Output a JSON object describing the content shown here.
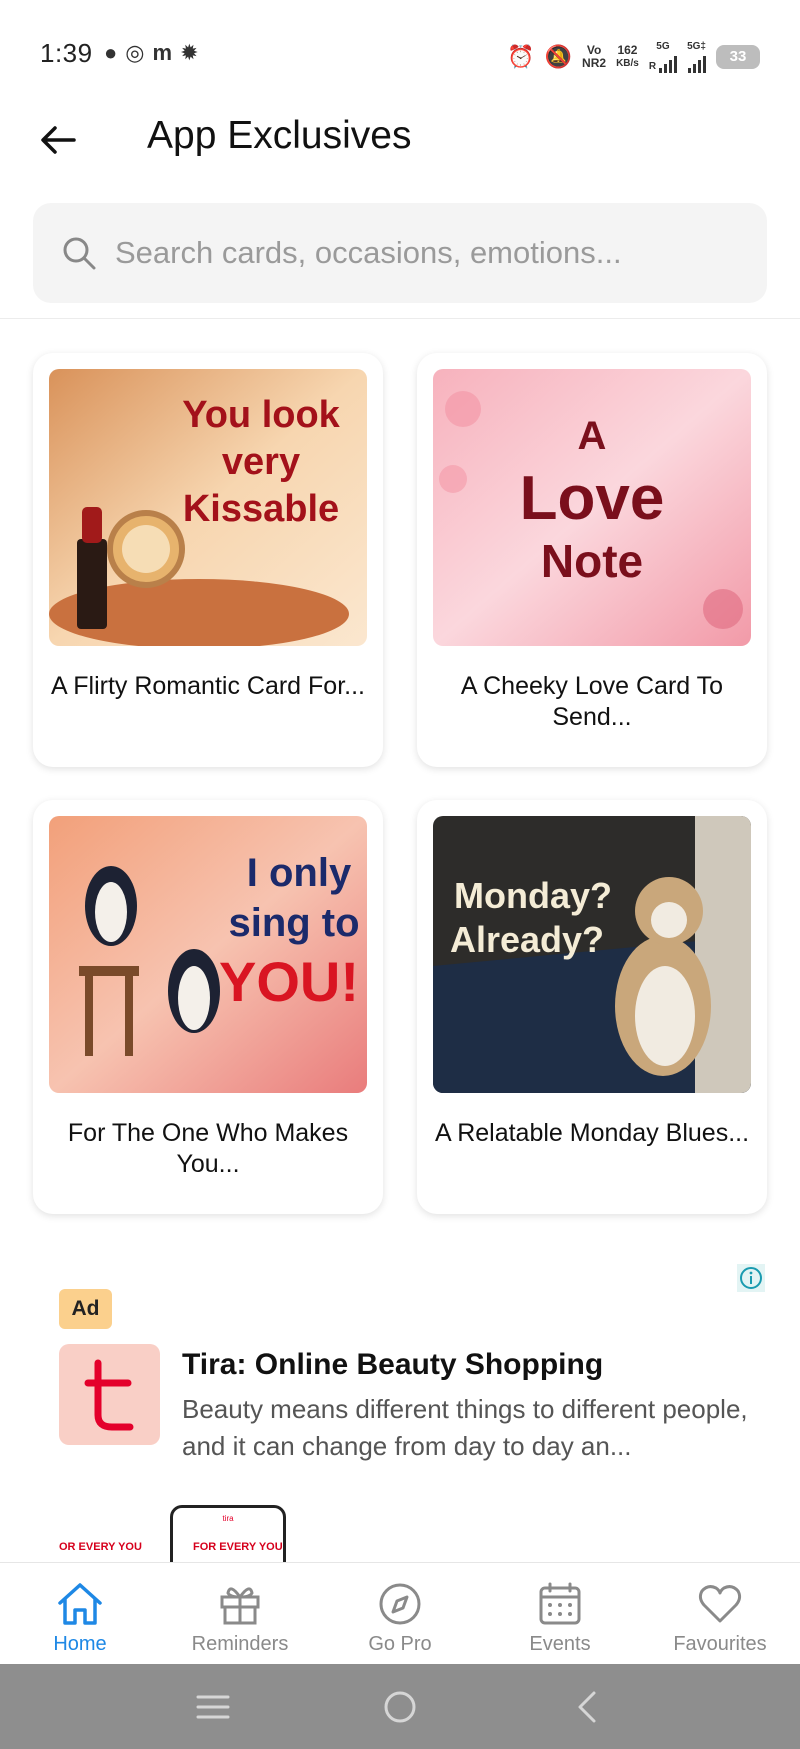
{
  "status_bar": {
    "time": "1:39",
    "net_vo": "Vo",
    "net_nr2": "NR2",
    "speed_value": "162",
    "speed_unit": "KB/s",
    "sig1_top": "5G",
    "sig1_bottom": "R",
    "sig2_top": "5G‡",
    "battery": "33"
  },
  "header": {
    "title": "App Exclusives"
  },
  "search": {
    "placeholder": "Search cards, occasions, emotions..."
  },
  "cards": [
    {
      "caption": "A Flirty Romantic Card For...",
      "image_lines": [
        "You look",
        "very",
        "Kissable"
      ]
    },
    {
      "caption": "A Cheeky Love Card To Send...",
      "image_lines": [
        "A",
        "Love",
        "Note"
      ]
    },
    {
      "caption": "For The One Who Makes You...",
      "image_lines": [
        "I only",
        "sing to",
        "YOU!"
      ]
    },
    {
      "caption": "A Relatable Monday Blues...",
      "image_lines": [
        "Monday?",
        "Already?"
      ]
    }
  ],
  "ad": {
    "badge": "Ad",
    "title": "Tira: Online Beauty Shopping",
    "description": "Beauty means different things to different people, and it can change from day to day an...",
    "strip_text": "OR EVERY YOU",
    "phone_strip_text": "FOR EVERY YOU",
    "brand_color": "#e4002b"
  },
  "bottom_nav": [
    {
      "label": "Home",
      "icon": "home-icon",
      "active": true
    },
    {
      "label": "Reminders",
      "icon": "gift-icon",
      "active": false
    },
    {
      "label": "Go Pro",
      "icon": "compass-icon",
      "active": false
    },
    {
      "label": "Events",
      "icon": "calendar-icon",
      "active": false
    },
    {
      "label": "Favourites",
      "icon": "heart-icon",
      "active": false
    }
  ],
  "colors": {
    "accent": "#1e88e5",
    "nav_inactive": "#8a8a8a",
    "search_bg": "#f4f4f4",
    "system_nav_bg": "#8e8e8e"
  }
}
